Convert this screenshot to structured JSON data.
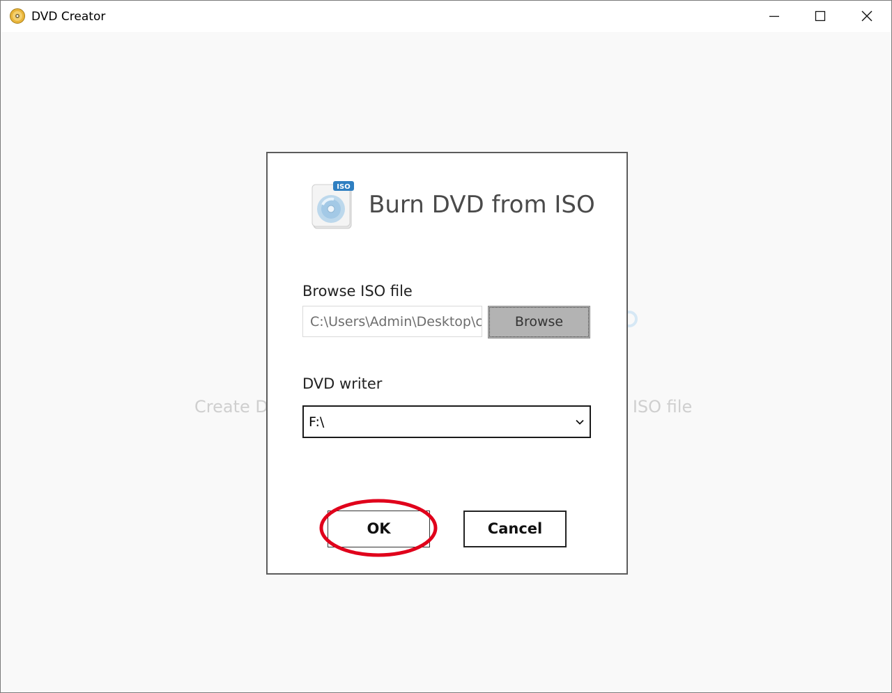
{
  "window": {
    "title": "DVD Creator",
    "controls": {
      "minimize": "minimize-icon",
      "maximize": "maximize-icon",
      "close": "close-icon"
    }
  },
  "background": {
    "text_left": "Create D",
    "text_right": "n ISO file"
  },
  "dialog": {
    "title": "Burn DVD from ISO",
    "icon_badge": "ISO",
    "browse_label": "Browse ISO file",
    "iso_path_value": "C:\\Users\\Admin\\Desktop\\c",
    "browse_button": "Browse",
    "writer_label": "DVD writer",
    "writer_selected": "F:\\",
    "ok_button": "OK",
    "cancel_button": "Cancel"
  },
  "colors": {
    "highlight_circle": "#e0001b",
    "browse_button_bg": "#b3b3b3",
    "window_bg": "#f9f9f9"
  }
}
